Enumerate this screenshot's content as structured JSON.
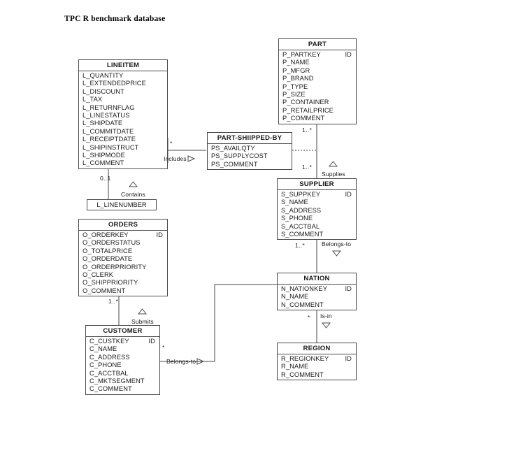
{
  "title": "TPC R benchmark database",
  "entities": {
    "lineitem": {
      "name": "LINEITEM",
      "attrs": [
        {
          "label": "L_QUANTITY",
          "id": ""
        },
        {
          "label": "L_EXTENDEDPRICE",
          "id": ""
        },
        {
          "label": "L_DISCOUNT",
          "id": ""
        },
        {
          "label": "L_TAX",
          "id": ""
        },
        {
          "label": "L_RETURNFLAG",
          "id": ""
        },
        {
          "label": "L_LINESTATUS",
          "id": ""
        },
        {
          "label": "L_SHIPDATE",
          "id": ""
        },
        {
          "label": "L_COMMITDATE",
          "id": ""
        },
        {
          "label": "L_RECEIPTDATE",
          "id": ""
        },
        {
          "label": "L_SHIPINSTRUCT",
          "id": ""
        },
        {
          "label": "L_SHIPMODE",
          "id": ""
        },
        {
          "label": "L_COMMENT",
          "id": ""
        }
      ]
    },
    "part": {
      "name": "PART",
      "attrs": [
        {
          "label": "P_PARTKEY",
          "id": "ID"
        },
        {
          "label": "P_NAME",
          "id": ""
        },
        {
          "label": "P_MFGR",
          "id": ""
        },
        {
          "label": "P_BRAND",
          "id": ""
        },
        {
          "label": "P_TYPE",
          "id": ""
        },
        {
          "label": "P_SIZE",
          "id": ""
        },
        {
          "label": "P_CONTAINER",
          "id": ""
        },
        {
          "label": "P_RETAILPRICE",
          "id": ""
        },
        {
          "label": "P_COMMENT",
          "id": ""
        }
      ]
    },
    "partshippedby": {
      "name": "PART-SHIIPPED-BY",
      "attrs": [
        {
          "label": "PS_AVAILQTY",
          "id": ""
        },
        {
          "label": "PS_SUPPLYCOST",
          "id": ""
        },
        {
          "label": "PS_COMMENT",
          "id": ""
        }
      ]
    },
    "supplier": {
      "name": "SUPPLIER",
      "attrs": [
        {
          "label": "S_SUPPKEY",
          "id": "ID"
        },
        {
          "label": "S_NAME",
          "id": ""
        },
        {
          "label": "S_ADDRESS",
          "id": ""
        },
        {
          "label": "S_PHONE",
          "id": ""
        },
        {
          "label": "S_ACCTBAL",
          "id": ""
        },
        {
          "label": "S_COMMENT",
          "id": ""
        }
      ]
    },
    "linenumber": {
      "name": "L_LINENUMBER"
    },
    "orders": {
      "name": "ORDERS",
      "attrs": [
        {
          "label": "O_ORDERKEY",
          "id": "ID"
        },
        {
          "label": "O_ORDERSTATUS",
          "id": ""
        },
        {
          "label": "O_TOTALPRICE",
          "id": ""
        },
        {
          "label": "O_ORDERDATE",
          "id": ""
        },
        {
          "label": "O_ORDERPRIORITY",
          "id": ""
        },
        {
          "label": "O_CLERK",
          "id": ""
        },
        {
          "label": "O_SHIPPRIORITY",
          "id": ""
        },
        {
          "label": "O_COMMENT",
          "id": ""
        }
      ]
    },
    "nation": {
      "name": "NATION",
      "attrs": [
        {
          "label": "N_NATIONKEY",
          "id": "ID"
        },
        {
          "label": "N_NAME",
          "id": ""
        },
        {
          "label": "N_COMMENT",
          "id": ""
        }
      ]
    },
    "customer": {
      "name": "CUSTOMER",
      "attrs": [
        {
          "label": "C_CUSTKEY",
          "id": "ID"
        },
        {
          "label": "C_NAME",
          "id": ""
        },
        {
          "label": "C_ADDRESS",
          "id": ""
        },
        {
          "label": "C_PHONE",
          "id": ""
        },
        {
          "label": "C_ACCTBAL",
          "id": ""
        },
        {
          "label": "C_MKTSEGMENT",
          "id": ""
        },
        {
          "label": "C_COMMENT",
          "id": ""
        }
      ]
    },
    "region": {
      "name": "REGION",
      "attrs": [
        {
          "label": "R_REGIONKEY",
          "id": "ID"
        },
        {
          "label": "R_NAME",
          "id": ""
        },
        {
          "label": "R_COMMENT",
          "id": ""
        }
      ]
    }
  },
  "relationships": {
    "includes": {
      "label": "Includes",
      "direction": "right"
    },
    "supplies": {
      "label": "Supplies",
      "direction": "up"
    },
    "contains": {
      "label": "Contains",
      "direction": "up"
    },
    "belongs_to_nation": {
      "label": "Belongs-to",
      "direction": "down"
    },
    "is_in": {
      "label": "Is-in",
      "direction": "down"
    },
    "submits": {
      "label": "Submits",
      "direction": "up"
    },
    "belongs_to_region": {
      "label": "Belongs-to",
      "direction": "right"
    }
  },
  "cardinalities": {
    "lineitem_includes": "*",
    "part_supplies": "1..*",
    "supplier_supplies": "1..*",
    "lineitem_contains": "0..1",
    "supplier_belongs_to": "1..*",
    "nation_is_in": "*",
    "orders_submits": "1..*",
    "customer_belongs_to": "*"
  },
  "colors": {
    "line": "#4a4a4a",
    "text": "#1a1a1a",
    "background": "#ffffff"
  }
}
